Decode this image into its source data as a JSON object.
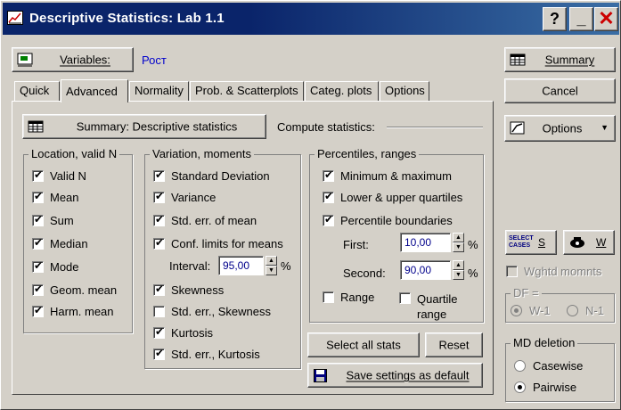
{
  "window": {
    "title": "Descriptive Statistics: Lab 1.1",
    "help": "?",
    "minimize": "_",
    "close": "✕"
  },
  "variables": {
    "button_label": "Variables:",
    "value": "Рост"
  },
  "tabs": [
    {
      "label": "Quick"
    },
    {
      "label": "Advanced"
    },
    {
      "label": "Normality"
    },
    {
      "label": "Prob. & Scatterplots"
    },
    {
      "label": "Categ. plots"
    },
    {
      "label": "Options"
    }
  ],
  "panel": {
    "summary_button": "Summary: Descriptive statistics",
    "compute_label": "Compute statistics:"
  },
  "location": {
    "title": "Location, valid N",
    "items": [
      {
        "label": "Valid N",
        "checked": true
      },
      {
        "label": "Mean",
        "checked": true
      },
      {
        "label": "Sum",
        "checked": true
      },
      {
        "label": "Median",
        "checked": true
      },
      {
        "label": "Mode",
        "checked": true
      },
      {
        "label": "Geom. mean",
        "checked": true
      },
      {
        "label": "Harm. mean",
        "checked": true
      }
    ]
  },
  "variation": {
    "title": "Variation, moments",
    "items": [
      {
        "label": "Standard Deviation",
        "checked": true
      },
      {
        "label": "Variance",
        "checked": true
      },
      {
        "label": "Std. err. of mean",
        "checked": true
      },
      {
        "label": "Conf. limits for means",
        "checked": true
      },
      {
        "label": "Skewness",
        "checked": true
      },
      {
        "label": "Std. err., Skewness",
        "checked": false
      },
      {
        "label": "Kurtosis",
        "checked": true
      },
      {
        "label": "Std. err., Kurtosis",
        "checked": true
      }
    ],
    "interval_label": "Interval:",
    "interval_value": "95,00",
    "percent": "%"
  },
  "percentiles": {
    "title": "Percentiles, ranges",
    "items": [
      {
        "label": "Minimum & maximum",
        "checked": true
      },
      {
        "label": "Lower & upper quartiles",
        "checked": true
      },
      {
        "label": "Percentile boundaries",
        "checked": true
      }
    ],
    "first_label": "First:",
    "first_value": "10,00",
    "second_label": "Second:",
    "second_value": "90,00",
    "percent": "%",
    "range_label": "Range",
    "range_checked": false,
    "quartile_label_1": "Quartile",
    "quartile_label_2": "range",
    "quartile_checked": false
  },
  "actions": {
    "select_all": "Select all stats",
    "reset": "Reset",
    "save_default": "Save settings as default"
  },
  "right": {
    "summary": "Summary",
    "cancel": "Cancel",
    "options": "Options",
    "select_cases_icon_text": "SELECT CASES",
    "select_cases_key": "S",
    "weight_key": "W",
    "wghtd_momnts": "Wghtd momnts",
    "df_title": "DF =",
    "df_options": [
      {
        "label": "W-1",
        "selected": true
      },
      {
        "label": "N-1",
        "selected": false
      }
    ],
    "md_title": "MD deletion",
    "md_options": [
      {
        "label": "Casewise",
        "selected": false
      },
      {
        "label": "Pairwise",
        "selected": true
      }
    ]
  },
  "colors": {
    "title_bar": "#0a246a",
    "face": "#d4d0c8",
    "value_text": "#00008b",
    "variables_value": "#0000cc"
  }
}
